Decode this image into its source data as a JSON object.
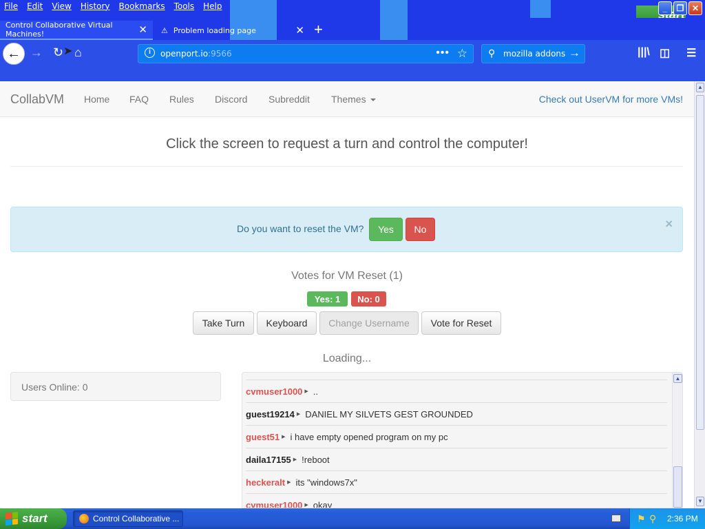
{
  "browser": {
    "menu": [
      "File",
      "Edit",
      "View",
      "History",
      "Bookmarks",
      "Tools",
      "Help"
    ],
    "tabs": [
      {
        "title": "Control Collaborative Virtual Machines!",
        "active": true
      },
      {
        "title": "Problem loading page",
        "active": false
      }
    ],
    "url_host": "openport.io",
    "url_port": ":9566",
    "search_query": "mozilla addons",
    "accent_color": "#1f39e8",
    "icons": [
      "back-icon",
      "forward-icon",
      "reload-icon",
      "home-icon",
      "info-icon",
      "page-actions-icon",
      "bookmark-star-icon",
      "search-icon",
      "arrow-right-icon",
      "library-icon",
      "sidebar-icon",
      "menu-icon"
    ]
  },
  "site": {
    "brand": "CollabVM",
    "nav": [
      "Home",
      "FAQ",
      "Rules",
      "Discord",
      "Subreddit",
      "Themes"
    ],
    "promo": "Check out UserVM for more VMs!",
    "headline": "Click the screen to request a turn and control the computer!",
    "reset": {
      "question": "Do you want to reset the VM?",
      "yes": "Yes",
      "no": "No",
      "close": "×"
    },
    "votes_title": "Votes for VM Reset (1)",
    "votes_yes": "Yes: 1",
    "votes_no": "No: 0",
    "buttons": {
      "take_turn": "Take Turn",
      "keyboard": "Keyboard",
      "change_username": "Change Username",
      "vote_reset": "Vote for Reset"
    },
    "loading": "Loading...",
    "users_online": "Users Online: 0",
    "chat": [
      {
        "user": "cvmuser1000",
        "color": "red",
        "text": ".."
      },
      {
        "user": "guest19214",
        "color": "black",
        "text": "DANIEL MY SILVETS GEST GROUNDED"
      },
      {
        "user": "guest51",
        "color": "red",
        "text": "i have empty opened program on my pc"
      },
      {
        "user": "daila17155",
        "color": "black",
        "text": "!reboot"
      },
      {
        "user": "heckeralt",
        "color": "red",
        "text": "its \"windows7x\""
      },
      {
        "user": "cvmuser1000",
        "color": "red",
        "text": "okay"
      }
    ]
  },
  "taskbar": {
    "start": "start",
    "task_title": "Control Collaborative ...",
    "time": "2:36 PM"
  }
}
